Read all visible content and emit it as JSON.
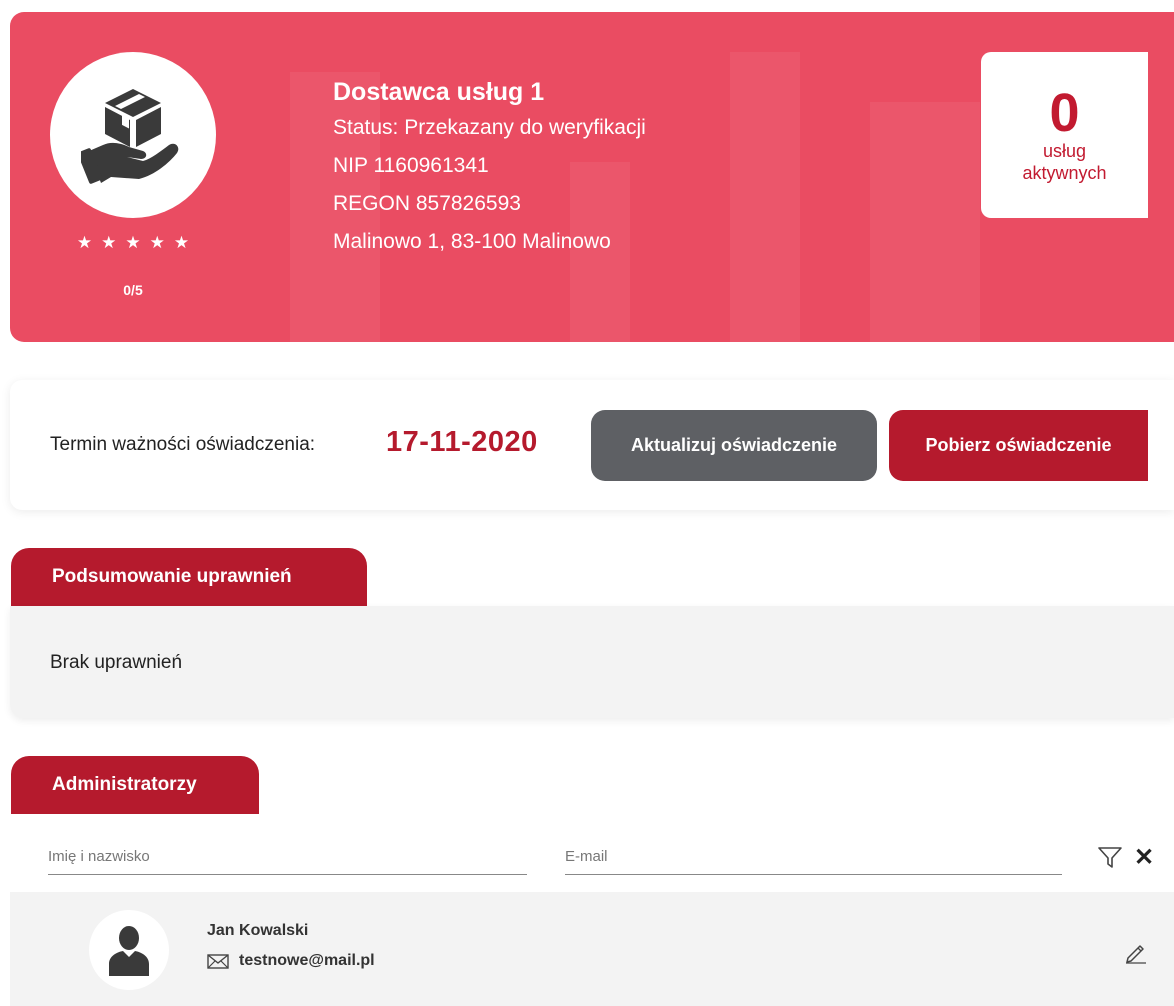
{
  "provider": {
    "name": "Dostawca usług 1",
    "status": "Status: Przekazany do weryfikacji",
    "nip": "NIP 1160961341",
    "regon": "REGON 857826593",
    "address": "Malinowo 1, 83-100 Malinowo",
    "rating_text": "0/5",
    "rating_value": 0,
    "rating_max": 5,
    "logo_icon": "hand-box-icon"
  },
  "active_services": {
    "count": "0",
    "label_line1": "usług",
    "label_line2": "aktywnych"
  },
  "declaration": {
    "label": "Termin ważności oświadczenia:",
    "date": "17-11-2020",
    "update_button": "Aktualizuj oświadczenie",
    "download_button": "Pobierz oświadczenie"
  },
  "permissions": {
    "tab_label": "Podsumowanie uprawnień",
    "empty_text": "Brak uprawnień"
  },
  "administrators": {
    "tab_label": "Administratorzy",
    "filter_name_placeholder": "Imię i nazwisko",
    "filter_email_placeholder": "E-mail",
    "rows": [
      {
        "name": "Jan Kowalski",
        "email": "testnowe@mail.pl"
      }
    ]
  },
  "colors": {
    "banner": "#ea4c62",
    "accent": "#b51a2d",
    "secondary_button": "#5e6064",
    "panel_background": "#f3f3f3"
  }
}
